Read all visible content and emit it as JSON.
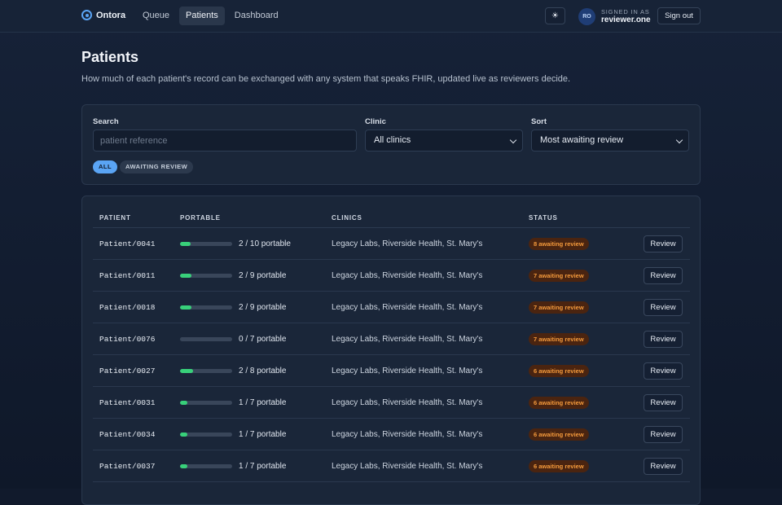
{
  "app": {
    "name": "Ontora"
  },
  "nav": [
    {
      "label": "Queue",
      "active": false
    },
    {
      "label": "Patients",
      "active": true
    },
    {
      "label": "Dashboard",
      "active": false
    }
  ],
  "header_right": {
    "theme_icon": "☀",
    "avatar_initials": "RO",
    "signed_in_label": "SIGNED IN AS",
    "username": "reviewer.one",
    "sign_out": "Sign out"
  },
  "page": {
    "title": "Patients",
    "description": "How much of each patient's record can be exchanged with any system that speaks FHIR, updated live as reviewers decide."
  },
  "filters": {
    "search_label": "Search",
    "search_placeholder": "patient reference",
    "search_value": "",
    "clinic_label": "Clinic",
    "clinic_value": "All clinics",
    "sort_label": "Sort",
    "sort_value": "Most awaiting review",
    "chips": [
      {
        "label": "ALL",
        "active": true
      },
      {
        "label": "AWAITING REVIEW",
        "active": false
      }
    ]
  },
  "table": {
    "columns": [
      "PATIENT",
      "PORTABLE",
      "CLINICS",
      "STATUS"
    ],
    "rows": [
      {
        "patient": "Patient/0041",
        "portable": "2 / 10 portable",
        "fraction": 0.2,
        "clinics": "Legacy Labs, Riverside Health, St. Mary's",
        "status": "8 awaiting review",
        "action": "Review"
      },
      {
        "patient": "Patient/0011",
        "portable": "2 / 9 portable",
        "fraction": 0.222,
        "clinics": "Legacy Labs, Riverside Health, St. Mary's",
        "status": "7 awaiting review",
        "action": "Review"
      },
      {
        "patient": "Patient/0018",
        "portable": "2 / 9 portable",
        "fraction": 0.222,
        "clinics": "Legacy Labs, Riverside Health, St. Mary's",
        "status": "7 awaiting review",
        "action": "Review"
      },
      {
        "patient": "Patient/0076",
        "portable": "0 / 7 portable",
        "fraction": 0.0,
        "clinics": "Legacy Labs, Riverside Health, St. Mary's",
        "status": "7 awaiting review",
        "action": "Review"
      },
      {
        "patient": "Patient/0027",
        "portable": "2 / 8 portable",
        "fraction": 0.25,
        "clinics": "Legacy Labs, Riverside Health, St. Mary's",
        "status": "6 awaiting review",
        "action": "Review"
      },
      {
        "patient": "Patient/0031",
        "portable": "1 / 7 portable",
        "fraction": 0.143,
        "clinics": "Legacy Labs, Riverside Health, St. Mary's",
        "status": "6 awaiting review",
        "action": "Review"
      },
      {
        "patient": "Patient/0034",
        "portable": "1 / 7 portable",
        "fraction": 0.143,
        "clinics": "Legacy Labs, Riverside Health, St. Mary's",
        "status": "6 awaiting review",
        "action": "Review"
      },
      {
        "patient": "Patient/0037",
        "portable": "1 / 7 portable",
        "fraction": 0.143,
        "clinics": "Legacy Labs, Riverside Health, St. Mary's",
        "status": "6 awaiting review",
        "action": "Review"
      }
    ]
  },
  "colors": {
    "accent": "#5aa4f4",
    "progress": "#38d07a",
    "badge_bg": "#4a2410",
    "badge_text": "#f49a3c"
  }
}
